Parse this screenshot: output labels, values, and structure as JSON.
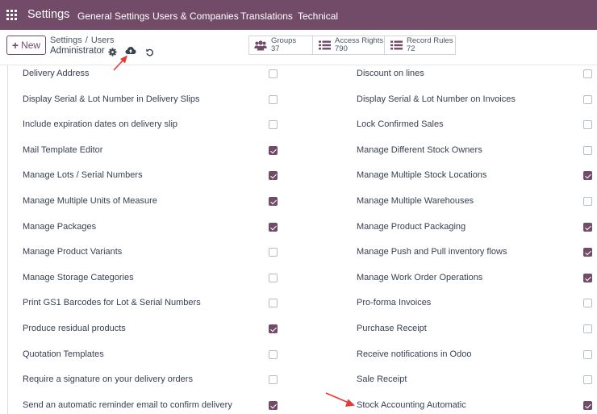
{
  "navbar": {
    "brand": "Settings",
    "menus": [
      "General Settings",
      "Users & Companies",
      "Translations",
      "Technical"
    ],
    "bg_color": "#714b67"
  },
  "control": {
    "new_label": "New",
    "breadcrumb": [
      "Settings",
      "Users"
    ],
    "record_name": "Administrator",
    "icons": [
      "gear-icon",
      "cloud-upload-icon",
      "undo-icon"
    ]
  },
  "stats": [
    {
      "label": "Groups",
      "count": "37",
      "icon": "users-icon"
    },
    {
      "label": "Access Rights",
      "count": "790",
      "icon": "list-icon"
    },
    {
      "label": "Record Rules",
      "count": "72",
      "icon": "list-icon"
    }
  ],
  "rows": [
    {
      "left": {
        "label": "Delivery Address",
        "checked": false
      },
      "right": {
        "label": "Discount on lines",
        "checked": false
      }
    },
    {
      "left": {
        "label": "Display Serial & Lot Number in Delivery Slips",
        "checked": false
      },
      "right": {
        "label": "Display Serial & Lot Number on Invoices",
        "checked": false
      }
    },
    {
      "left": {
        "label": "Include expiration dates on delivery slip",
        "checked": false
      },
      "right": {
        "label": "Lock Confirmed Sales",
        "checked": false
      }
    },
    {
      "left": {
        "label": "Mail Template Editor",
        "checked": true
      },
      "right": {
        "label": "Manage Different Stock Owners",
        "checked": false
      }
    },
    {
      "left": {
        "label": "Manage Lots / Serial Numbers",
        "checked": true
      },
      "right": {
        "label": "Manage Multiple Stock Locations",
        "checked": true
      }
    },
    {
      "left": {
        "label": "Manage Multiple Units of Measure",
        "checked": true
      },
      "right": {
        "label": "Manage Multiple Warehouses",
        "checked": false
      }
    },
    {
      "left": {
        "label": "Manage Packages",
        "checked": true
      },
      "right": {
        "label": "Manage Product Packaging",
        "checked": true
      }
    },
    {
      "left": {
        "label": "Manage Product Variants",
        "checked": false
      },
      "right": {
        "label": "Manage Push and Pull inventory flows",
        "checked": true
      }
    },
    {
      "left": {
        "label": "Manage Storage Categories",
        "checked": false
      },
      "right": {
        "label": "Manage Work Order Operations",
        "checked": true
      }
    },
    {
      "left": {
        "label": "Print GS1 Barcodes for Lot & Serial Numbers",
        "checked": false
      },
      "right": {
        "label": "Pro-forma Invoices",
        "checked": false
      }
    },
    {
      "left": {
        "label": "Produce residual products",
        "checked": true
      },
      "right": {
        "label": "Purchase Receipt",
        "checked": false
      }
    },
    {
      "left": {
        "label": "Quotation Templates",
        "checked": false
      },
      "right": {
        "label": "Receive notifications in Odoo",
        "checked": false
      }
    },
    {
      "left": {
        "label": "Require a signature on your delivery orders",
        "checked": false
      },
      "right": {
        "label": "Sale Receipt",
        "checked": false
      }
    },
    {
      "left": {
        "label": "Send an automatic reminder email to confirm delivery",
        "checked": true
      },
      "right": {
        "label": "Stock Accounting Automatic",
        "checked": true
      }
    }
  ],
  "annotations": {
    "arrow_color": "#e53935"
  }
}
